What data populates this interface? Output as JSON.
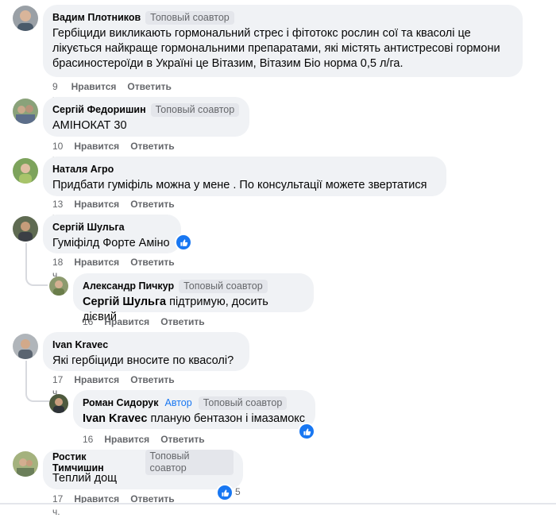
{
  "colors": {
    "like_blue": "#1877f2",
    "bubble_bg": "#f0f2f5",
    "meta_gray": "#65676b"
  },
  "actions": {
    "like": "Нравится",
    "reply": "Ответить"
  },
  "comments": [
    {
      "author": "Вадим Плотников",
      "badge": "Топовый соавтор",
      "lines": [
        "Гербіциди викликають гормональний стрес і фітотокс рослин сої та квасолі це",
        "лікується найкраще гормональними препаратами, які містять антистресові гормони",
        "брасиностероїди в Україні це Вітазим, Вітазим Біо норма 0,5 л/га."
      ],
      "time": "9 ч."
    },
    {
      "author": "Сергій Федоришин",
      "badge": "Топовый соавтор",
      "text": "АМІНОКАТ 30",
      "time": "10 ч."
    },
    {
      "author": "Наталя Агро",
      "text": "Придбати гуміфіль можна у мене . По консультації можете звертатися",
      "time": "13 ч."
    },
    {
      "author": "Сергій Шульга",
      "text": "Гуміфілд Форте Аміно",
      "time": "18 ч.",
      "reaction_icon": "like-icon"
    },
    {
      "author": "Александр Пичкур",
      "badge": "Топовый соавтор",
      "mention": "Сергій Шульга",
      "text": " підтримую, досить дієвий",
      "time": "16 ч."
    },
    {
      "author": "Ivan Kravec",
      "text": "Які гербіциди вносите по квасолі?",
      "time": "17 ч."
    },
    {
      "author": "Роман Сидорук",
      "author_badge": "Автор",
      "badge": "Топовый соавтор",
      "mention": "Ivan Kravec",
      "text": " планую бентазон і імазамокс",
      "time": "16 ч.",
      "reaction_icon": "like-icon"
    },
    {
      "author": "Ростик Тимчишин",
      "badge": "Топовый соавтор",
      "text": "Теплий дощ",
      "time": "17 ч.",
      "reaction_icon": "like-icon",
      "reaction_count": "5"
    }
  ]
}
